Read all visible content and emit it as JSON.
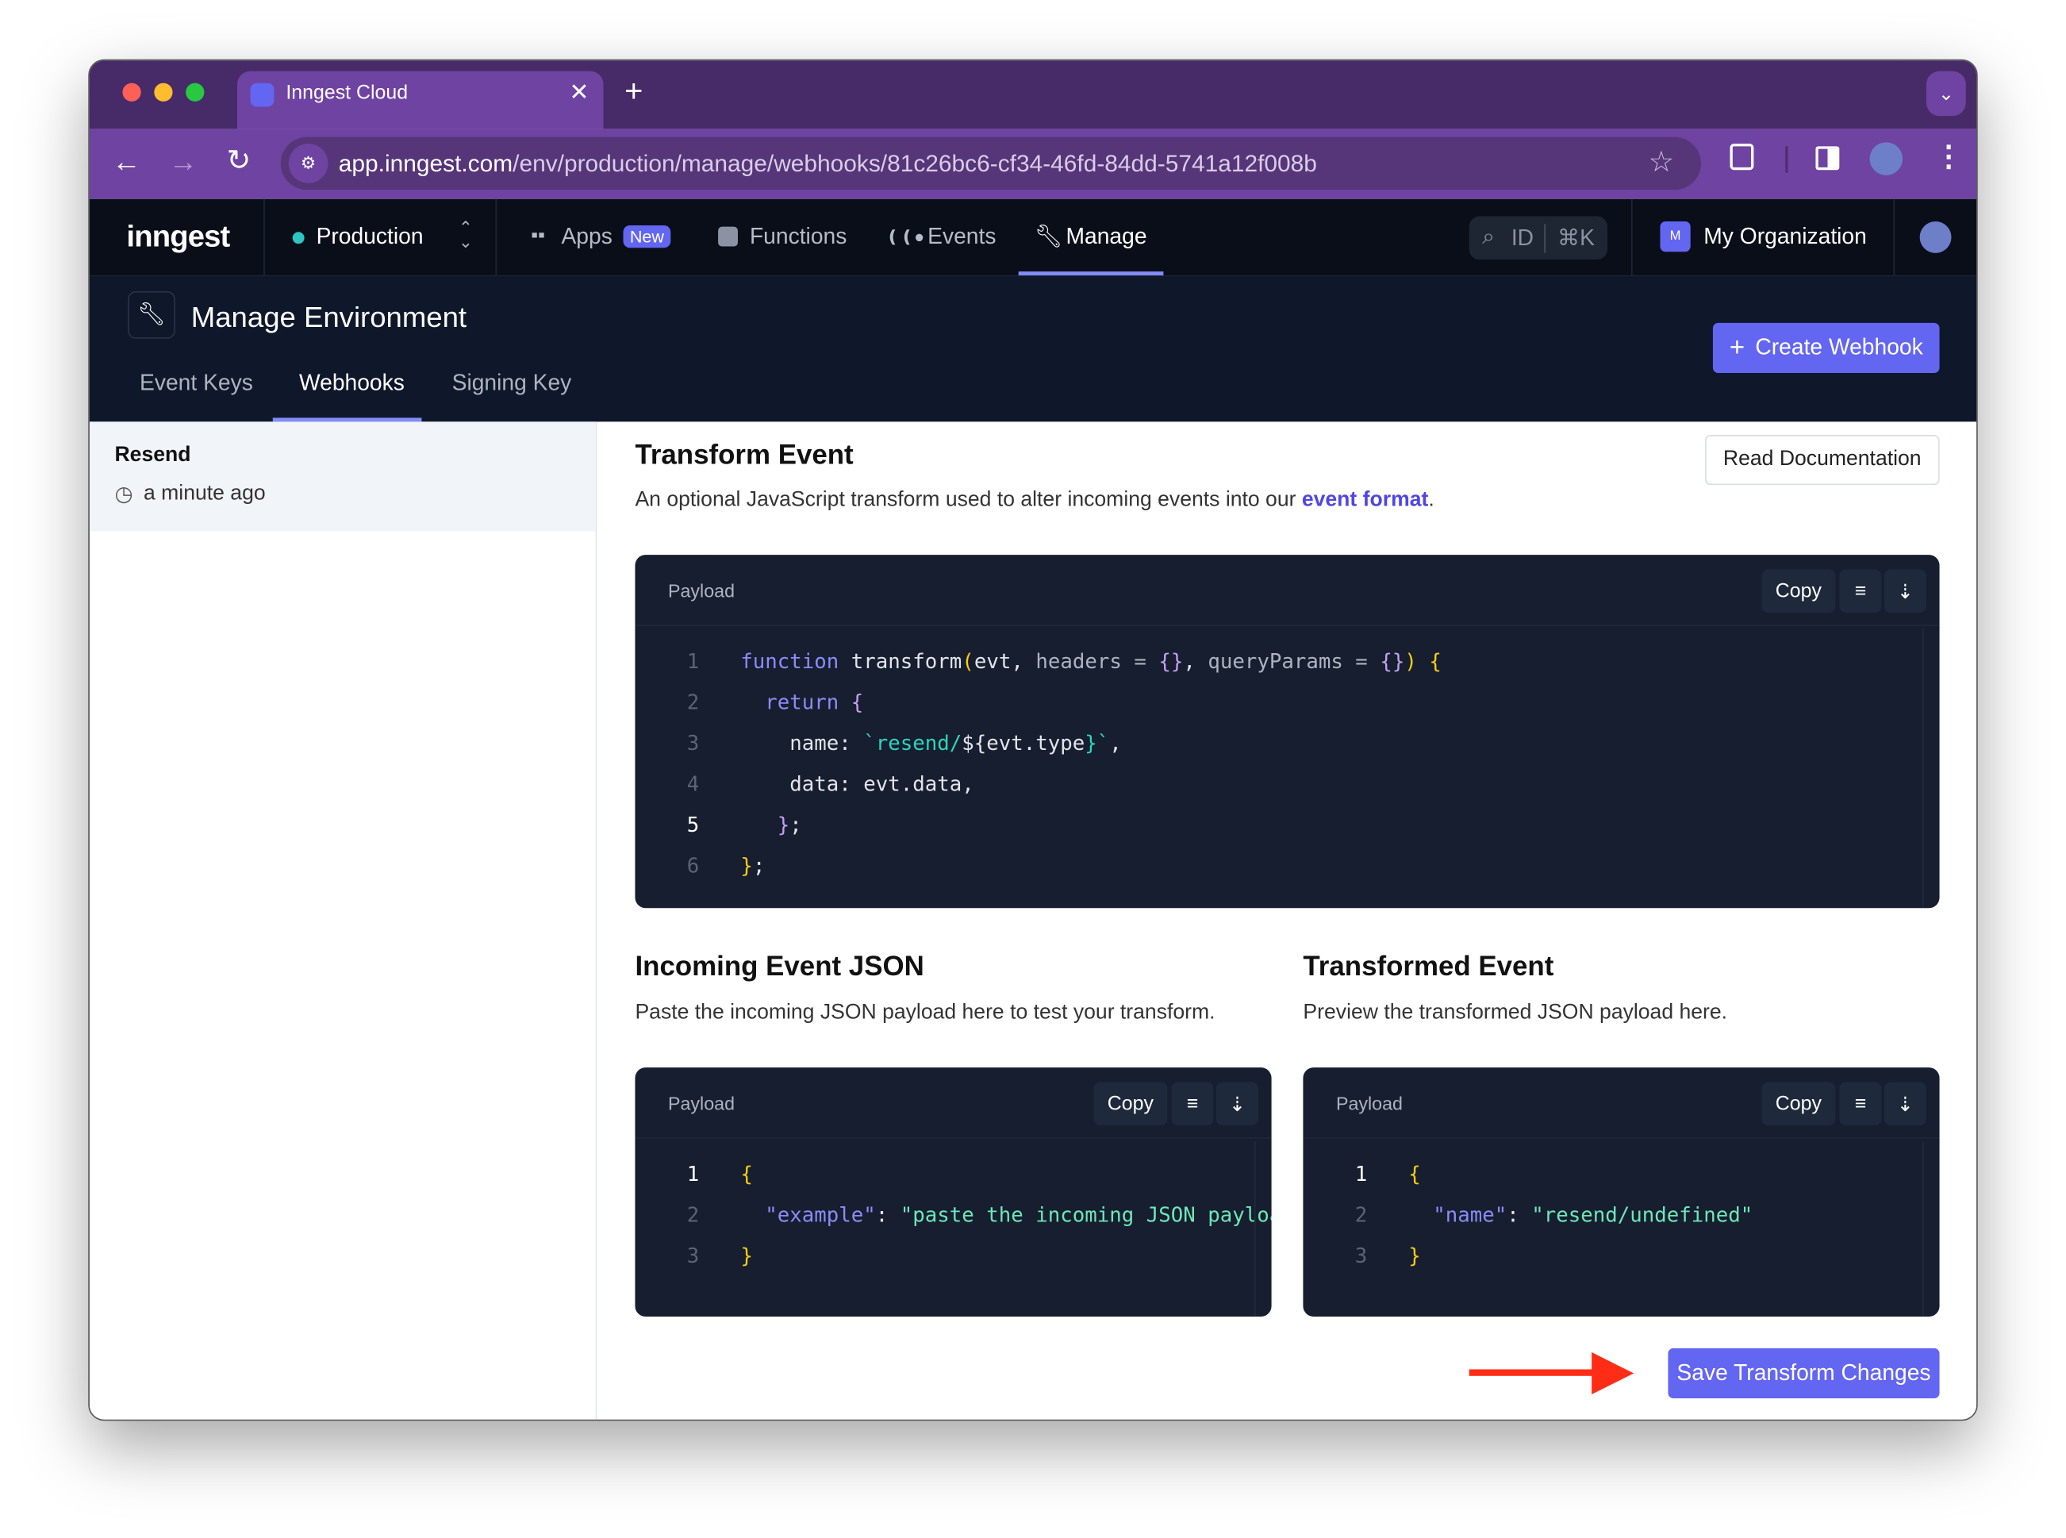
{
  "browser": {
    "tab_title": "Inngest Cloud",
    "url_host": "app.inngest.com",
    "url_path": "/env/production/manage/webhooks/81c26bc6-cf34-46fd-84dd-5741a12f008b"
  },
  "appnav": {
    "logo": "inngest",
    "environment": "Production",
    "items": [
      {
        "label": "Apps",
        "badge": "New"
      },
      {
        "label": "Functions"
      },
      {
        "label": "Events"
      },
      {
        "label": "Manage"
      }
    ],
    "search_label": "ID",
    "search_shortcut": "⌘K",
    "org_initial": "M",
    "org_name": "My Organization"
  },
  "subheader": {
    "title": "Manage Environment",
    "tabs": [
      "Event Keys",
      "Webhooks",
      "Signing Key"
    ],
    "active_tab": "Webhooks",
    "create_button": "Create Webhook"
  },
  "sidebar": {
    "items": [
      {
        "name": "Resend",
        "time": "a minute ago"
      }
    ]
  },
  "transform": {
    "title": "Transform Event",
    "desc_prefix": "An optional JavaScript transform used to alter incoming events into our ",
    "desc_link": "event format",
    "desc_suffix": ".",
    "docs_button": "Read Documentation",
    "editor_label": "Payload",
    "copy": "Copy",
    "lines": [
      [
        [
          "function ",
          "#8b8cf8"
        ],
        [
          "transform",
          "#e2e5ea"
        ],
        [
          "(",
          "#facc15"
        ],
        [
          "evt, ",
          "#e2e5ea"
        ],
        [
          "headers = ",
          "#aeb4bf"
        ],
        [
          "{}",
          "#c4a0f0"
        ],
        [
          ", ",
          "#e2e5ea"
        ],
        [
          "queryParams = ",
          "#aeb4bf"
        ],
        [
          "{}",
          "#c4a0f0"
        ],
        [
          ")",
          "#facc15"
        ],
        [
          " {",
          "#facc15"
        ]
      ],
      [
        [
          "  return ",
          "#8b8cf8"
        ],
        [
          "{",
          "#c4a0f0"
        ]
      ],
      [
        [
          "    name: ",
          "#e2e5ea"
        ],
        [
          "`resend/",
          "#2dd4bf"
        ],
        [
          "${",
          "#e2e5ea"
        ],
        [
          "evt.type",
          "#e2e5ea"
        ],
        [
          "}",
          "#2dd4bf"
        ],
        [
          "`",
          "#2dd4bf"
        ],
        [
          ",",
          "#e2e5ea"
        ]
      ],
      [
        [
          "    data: evt.data,",
          "#e2e5ea"
        ]
      ],
      [
        [
          "   }",
          "#c4a0f0"
        ],
        [
          ";",
          "#e2e5ea"
        ]
      ],
      [
        [
          "}",
          "#facc15"
        ],
        [
          ";",
          "#e2e5ea"
        ]
      ]
    ]
  },
  "incoming": {
    "title": "Incoming Event JSON",
    "desc": "Paste the incoming JSON payload here to test your transform.",
    "editor_label": "Payload",
    "copy": "Copy",
    "lines": [
      [
        [
          "{",
          "#facc15"
        ]
      ],
      [
        [
          "  \"example\"",
          "#8b8cf8"
        ],
        [
          ": ",
          "#e2e5ea"
        ],
        [
          "\"paste the incoming JSON payload here\"",
          "#6ee7b7"
        ]
      ],
      [
        [
          "}",
          "#facc15"
        ]
      ]
    ]
  },
  "transformed": {
    "title": "Transformed Event",
    "desc": "Preview the transformed JSON payload here.",
    "editor_label": "Payload",
    "copy": "Copy",
    "lines": [
      [
        [
          "{",
          "#facc15"
        ]
      ],
      [
        [
          "  \"name\"",
          "#8b8cf8"
        ],
        [
          ": ",
          "#e2e5ea"
        ],
        [
          "\"resend/undefined\"",
          "#6ee7b7"
        ]
      ],
      [
        [
          "}",
          "#facc15"
        ]
      ]
    ]
  },
  "save_button": "Save Transform Changes",
  "colors": {
    "accent": "#6366f1",
    "browser": "#6f43a1",
    "annotation_arrow": "#ff2d16"
  }
}
